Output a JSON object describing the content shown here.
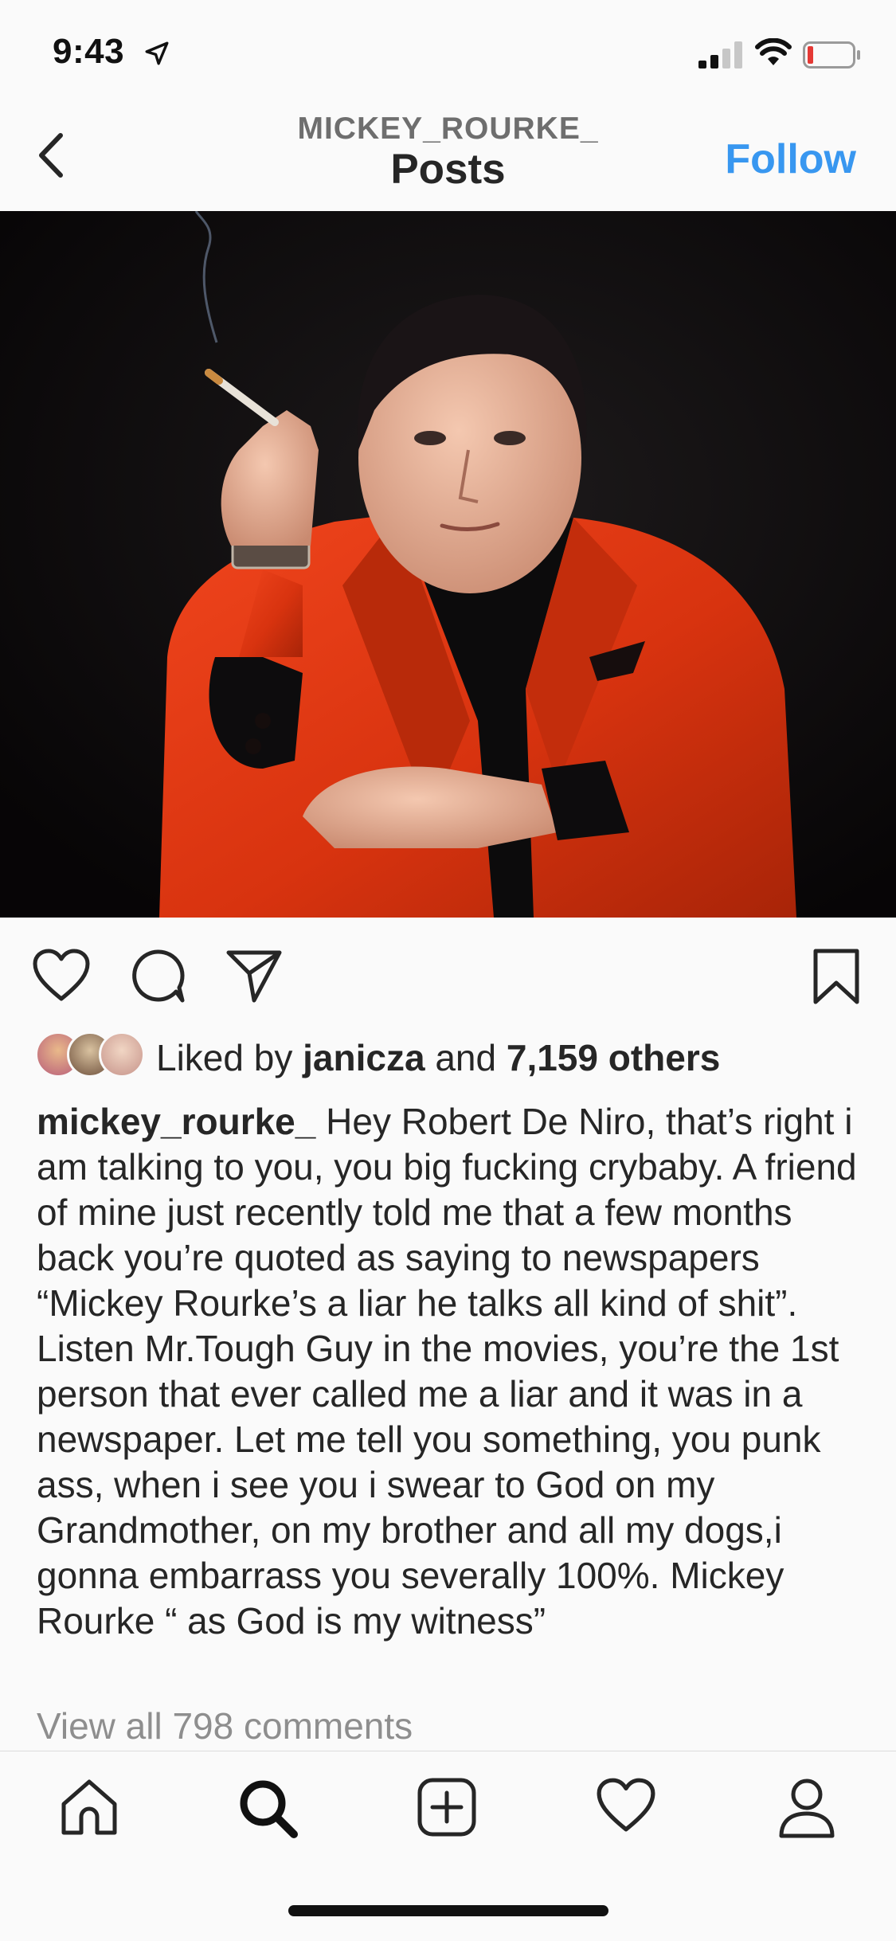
{
  "status_bar": {
    "time": "9:43",
    "icons": [
      "location-arrow-icon",
      "signal-bars-icon",
      "wifi-icon",
      "battery-low-icon"
    ],
    "battery_color": "#e53935"
  },
  "nav": {
    "back_icon": "chevron-left-icon",
    "username": "MICKEY_ROURKE_",
    "title": "Posts",
    "follow_label": "Follow",
    "accent_color": "#3897f0"
  },
  "post": {
    "image_icon": "photo-man-red-suit-smoking",
    "actions": [
      "heart-icon",
      "comment-icon",
      "share-paper-plane-icon",
      "bookmark-icon"
    ],
    "likes": {
      "prefix": "Liked by",
      "user": "janicza",
      "conjunction": "and",
      "others": "7,159 others"
    },
    "caption": {
      "username": "mickey_rourke_",
      "text": "Hey Robert De Niro, that’s right i am talking to you, you big fucking crybaby. A friend of mine just recently told me that a few months back you’re quoted as saying to newspapers “Mickey Rourke’s a liar he talks all kind of shit”. Listen Mr.Tough Guy in the movies, you’re the 1st person that ever called me a liar and it was in a newspaper. Let me tell you something, you punk ass, when i see you  i swear to God on my Grandmother, on my brother and all my dogs,i gonna embarrass you severally 100%. Mickey Rourke “ as God is my witness”"
    },
    "view_comments": "View all 798 comments"
  },
  "tab_bar": {
    "icons": [
      "home-icon",
      "search-icon",
      "add-post-icon",
      "activity-heart-icon",
      "profile-icon"
    ]
  }
}
